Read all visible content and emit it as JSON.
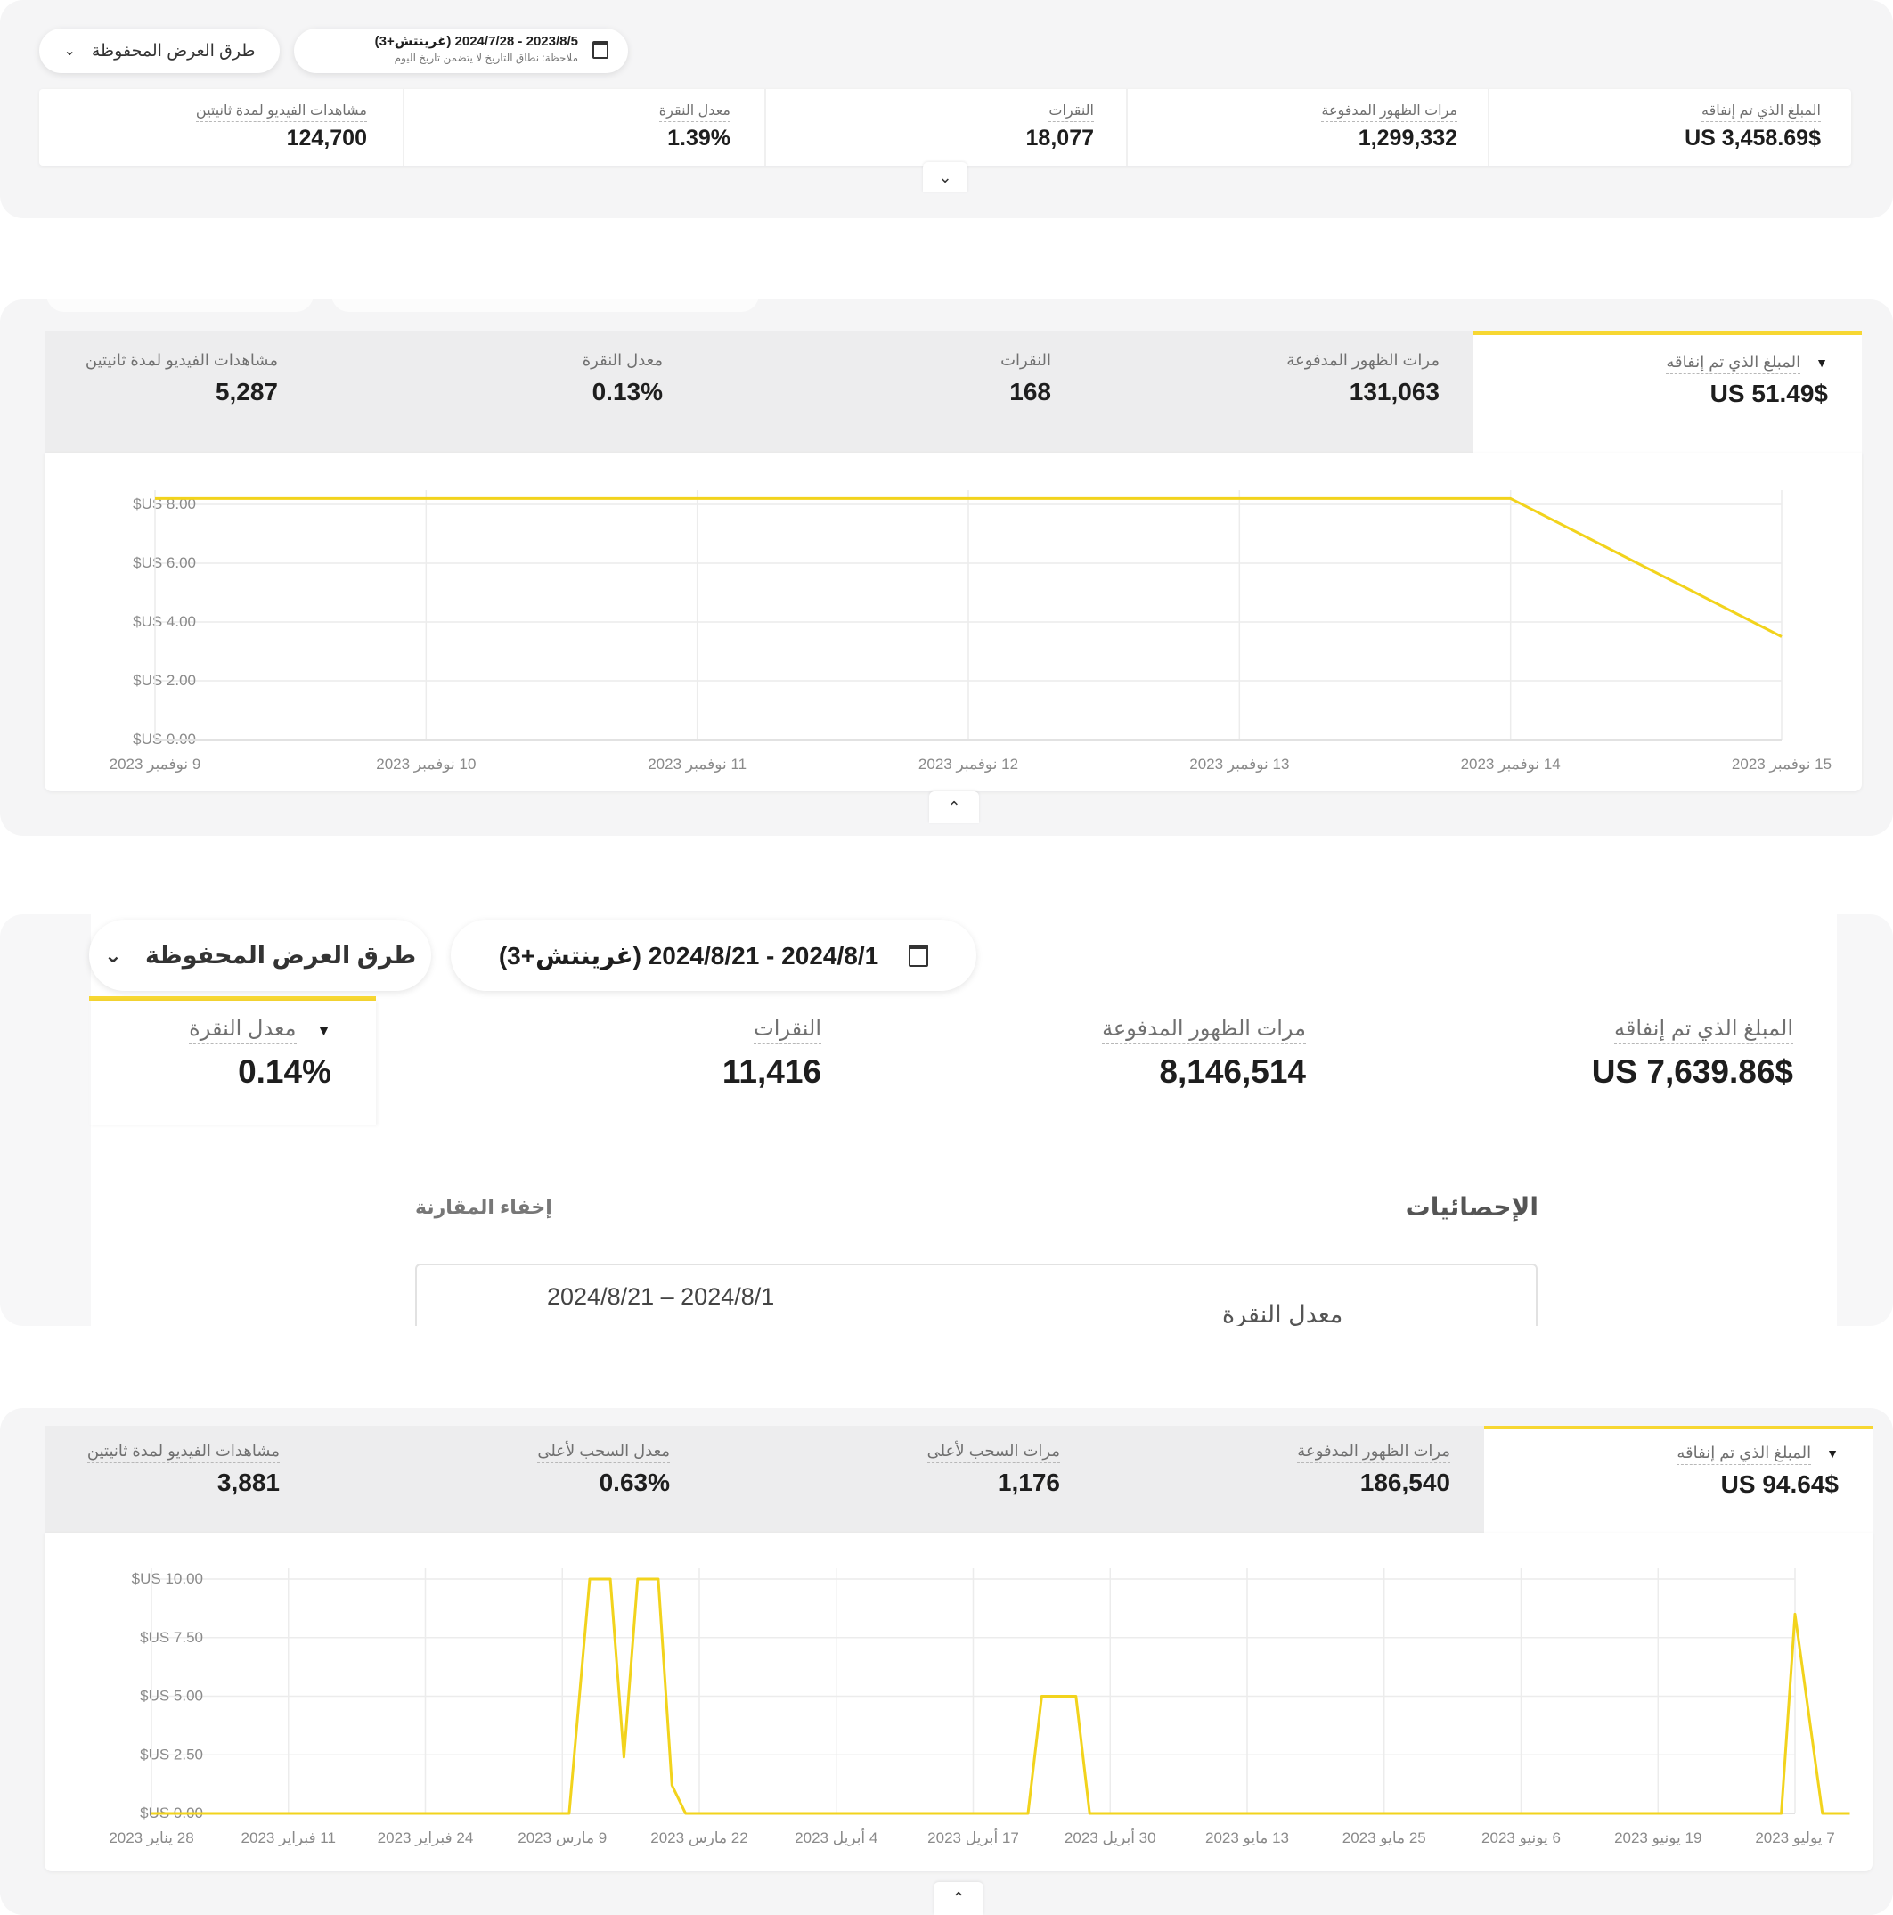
{
  "panel1": {
    "saved_views": "طرق العرض المحفوظة",
    "date_range": "2023/8/5 - 2024/7/28 (غرينتش+3)",
    "date_note": "ملاحظة: نطاق التاريخ لا يتضمن تاريخ اليوم",
    "metrics": [
      {
        "label": "المبلغ الذي تم إنفاقه",
        "value": "$US 3,458.69"
      },
      {
        "label": "مرات الظهور المدفوعة",
        "value": "1,299,332"
      },
      {
        "label": "النقرات",
        "value": "18,077"
      },
      {
        "label": "معدل النقرة",
        "value": "1.39%"
      },
      {
        "label": "مشاهدات الفيديو لمدة ثانيتين",
        "value": "124,700"
      }
    ]
  },
  "panel2": {
    "metrics": [
      {
        "label": "المبلغ الذي تم إنفاقه",
        "value": "$US 51.49"
      },
      {
        "label": "مرات الظهور المدفوعة",
        "value": "131,063"
      },
      {
        "label": "النقرات",
        "value": "168"
      },
      {
        "label": "معدل النقرة",
        "value": "0.13%"
      },
      {
        "label": "مشاهدات الفيديو لمدة ثانيتين",
        "value": "5,287"
      }
    ]
  },
  "panel3": {
    "saved_views": "طرق العرض المحفوظة",
    "date_range": "2024/8/1 - 2024/8/21 (غرينتش+3)",
    "metrics": [
      {
        "label": "المبلغ الذي تم إنفاقه",
        "value": "$US 7,639.86"
      },
      {
        "label": "مرات الظهور المدفوعة",
        "value": "8,146,514"
      },
      {
        "label": "النقرات",
        "value": "11,416"
      },
      {
        "label": "معدل النقرة",
        "value": "0.14%"
      }
    ],
    "stats_title": "الإحصائيات",
    "hide_compare": "إخفاء المقارنة",
    "table_date": "2024/8/1 – 2024/8/21",
    "table_metric": "معدل النقرة"
  },
  "panel4": {
    "metrics": [
      {
        "label": "المبلغ الذي تم إنفاقه",
        "value": "$US 94.64"
      },
      {
        "label": "مرات الظهور المدفوعة",
        "value": "186,540"
      },
      {
        "label": "مرات السحب لأعلى",
        "value": "1,176"
      },
      {
        "label": "معدل السحب لأعلى",
        "value": "0.63%"
      },
      {
        "label": "مشاهدات الفيديو لمدة ثانيتين",
        "value": "3,881"
      }
    ]
  },
  "colors": {
    "accent": "#f7d732",
    "line": "#f2d31c"
  },
  "chart_data": [
    {
      "type": "line",
      "title": "",
      "xlabel": "",
      "ylabel": "",
      "x": [
        "9 نوفمبر 2023",
        "10 نوفمبر 2023",
        "11 نوفمبر 2023",
        "12 نوفمبر 2023",
        "13 نوفمبر 2023",
        "14 نوفمبر 2023",
        "15 نوفمبر 2023"
      ],
      "yticks": [
        "$US 0.00",
        "$US 2.00",
        "$US 4.00",
        "$US 6.00",
        "$US 8.00"
      ],
      "ylim": [
        0,
        8
      ],
      "series": [
        {
          "values": [
            8.2,
            8.2,
            8.2,
            8.2,
            8.2,
            8.2,
            3.5
          ]
        }
      ],
      "grid": true
    },
    {
      "type": "line",
      "title": "",
      "xlabel": "",
      "ylabel": "",
      "x": [
        "28 يناير 2023",
        "11 فبراير 2023",
        "24 فبراير 2023",
        "9 مارس 2023",
        "22 مارس 2023",
        "4 أبريل 2023",
        "17 أبريل 2023",
        "30 أبريل 2023",
        "13 مايو 2023",
        "25 مايو 2023",
        "6 يونيو 2023",
        "19 يونيو 2023",
        "7 يوليو 2023"
      ],
      "yticks": [
        "$US 0.00",
        "$US 2.50",
        "$US 5.00",
        "$US 7.50",
        "$US 10.00"
      ],
      "ylim": [
        0,
        10
      ],
      "series": [
        {
          "points": [
            [
              0,
              0
            ],
            [
              3.05,
              0
            ],
            [
              3.2,
              10
            ],
            [
              3.35,
              10
            ],
            [
              3.45,
              2.4
            ],
            [
              3.55,
              10
            ],
            [
              3.7,
              10
            ],
            [
              3.8,
              1.2
            ],
            [
              3.9,
              0
            ],
            [
              6.4,
              0
            ],
            [
              6.5,
              5
            ],
            [
              6.75,
              5
            ],
            [
              6.85,
              0
            ],
            [
              11.9,
              0
            ],
            [
              12.0,
              8.5
            ],
            [
              12.2,
              0
            ],
            [
              12.4,
              0
            ]
          ]
        }
      ],
      "grid": true
    }
  ]
}
